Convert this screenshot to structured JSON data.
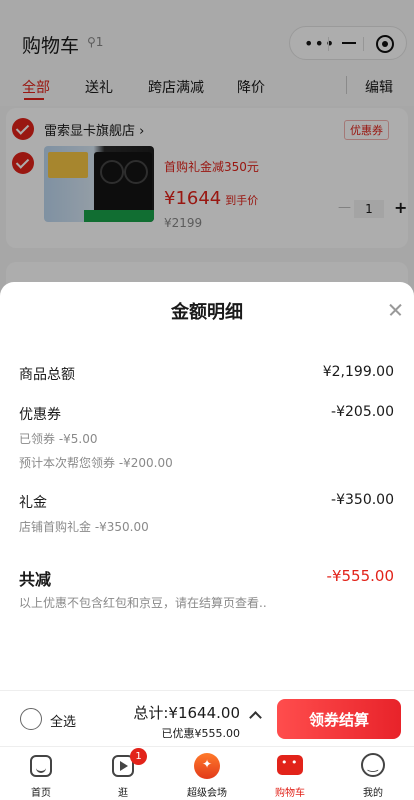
{
  "header": {
    "title": "购物车",
    "location_count": "1"
  },
  "tabs": [
    {
      "label": "全部"
    },
    {
      "label": "送礼"
    },
    {
      "label": "跨店满减"
    },
    {
      "label": "降价"
    }
  ],
  "edit_label": "编辑",
  "store": {
    "name": "雷索显卡旗舰店 ›",
    "coupon_tag": "优惠券"
  },
  "product": {
    "promo": "首购礼金减350元",
    "price": "¥1644",
    "price_tail": "到手价",
    "original_price": "¥2199",
    "quantity": "1"
  },
  "detail_sheet": {
    "title": "金额明细",
    "goods_total_label": "商品总额",
    "goods_total_value": "¥2,199.00",
    "coupon_label": "优惠券",
    "coupon_value": "-¥205.00",
    "coupon_claimed": "已领券 -¥5.00",
    "coupon_estimated": "预计本次帮您领券 -¥200.00",
    "gift_label": "礼金",
    "gift_value": "-¥350.00",
    "gift_detail": "店铺首购礼金 -¥350.00",
    "total_reduction_label": "共减",
    "total_reduction_value": "-¥555.00",
    "note": "以上优惠不包含红包和京豆，请在结算页查看.."
  },
  "checkout": {
    "select_all": "全选",
    "total": "总计:¥1644.00",
    "saved": "已优惠¥555.00",
    "pay_button": "领券结算"
  },
  "tabbar": {
    "items": [
      {
        "label": "首页",
        "icon": "home-icon"
      },
      {
        "label": "逛",
        "icon": "video-icon",
        "badge": "1"
      },
      {
        "label": "超级会场",
        "icon": "venue-icon"
      },
      {
        "label": "购物车",
        "icon": "cart-icon"
      },
      {
        "label": "我的",
        "icon": "profile-icon"
      }
    ]
  },
  "colors": {
    "accent": "#e2231a",
    "text": "#1a1a1a",
    "muted": "#8a8a8a"
  }
}
